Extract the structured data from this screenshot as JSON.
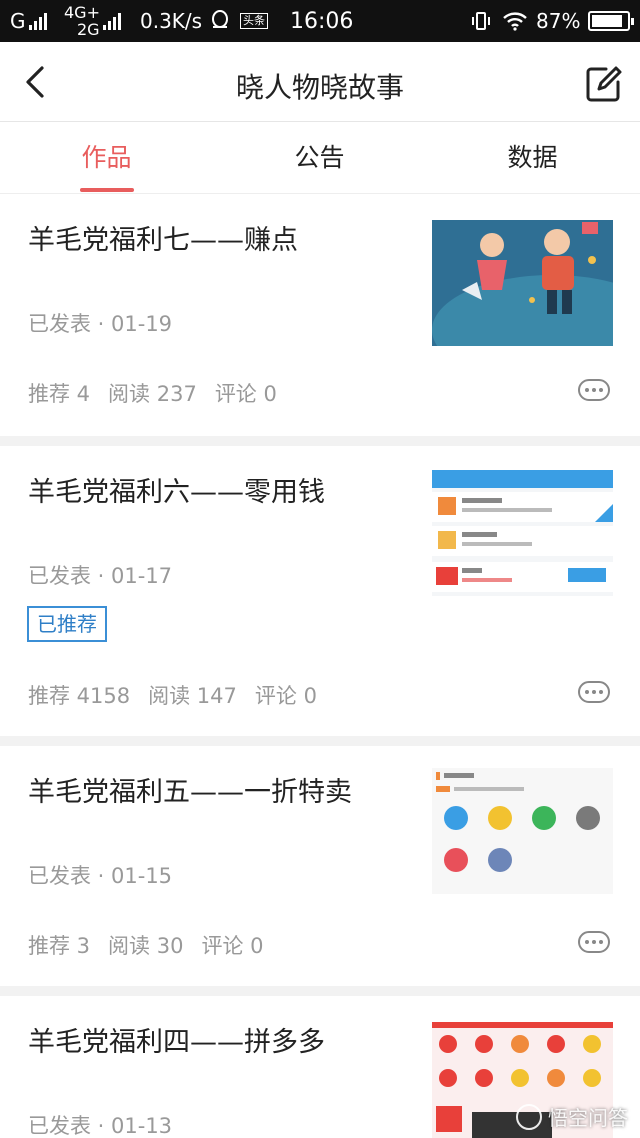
{
  "status_bar": {
    "carrier1": "G",
    "net1": "4G+",
    "net2": "2G",
    "speed": "0.3K/s",
    "badge": "头条",
    "time": "16:06",
    "battery": "87%",
    "battery_level": 0.87
  },
  "header": {
    "title": "晓人物晓故事",
    "back_icon": "chevron-left-icon",
    "edit_icon": "edit-icon"
  },
  "tabs": [
    {
      "label": "作品",
      "active": true
    },
    {
      "label": "公告",
      "active": false
    },
    {
      "label": "数据",
      "active": false
    }
  ],
  "articles": [
    {
      "title": "羊毛党福利七——赚点",
      "status": "已发表 · 01-19",
      "stats": [
        "推荐 4",
        "阅读 237",
        "评论 0"
      ]
    },
    {
      "title": "羊毛党福利六——零用钱",
      "status": "已发表 · 01-17",
      "tag": "已推荐",
      "stats": [
        "推荐 4158",
        "阅读 147",
        "评论 0"
      ]
    },
    {
      "title": "羊毛党福利五——一折特卖",
      "status": "已发表 · 01-15",
      "stats": [
        "推荐 3",
        "阅读 30",
        "评论 0"
      ]
    },
    {
      "title": "羊毛党福利四——拼多多",
      "status": "已发表 · 01-13"
    }
  ],
  "watermark": "悟空问答",
  "colors": {
    "accent": "#e85d5d",
    "tag_blue": "#3b8fd6",
    "muted": "#999999"
  }
}
